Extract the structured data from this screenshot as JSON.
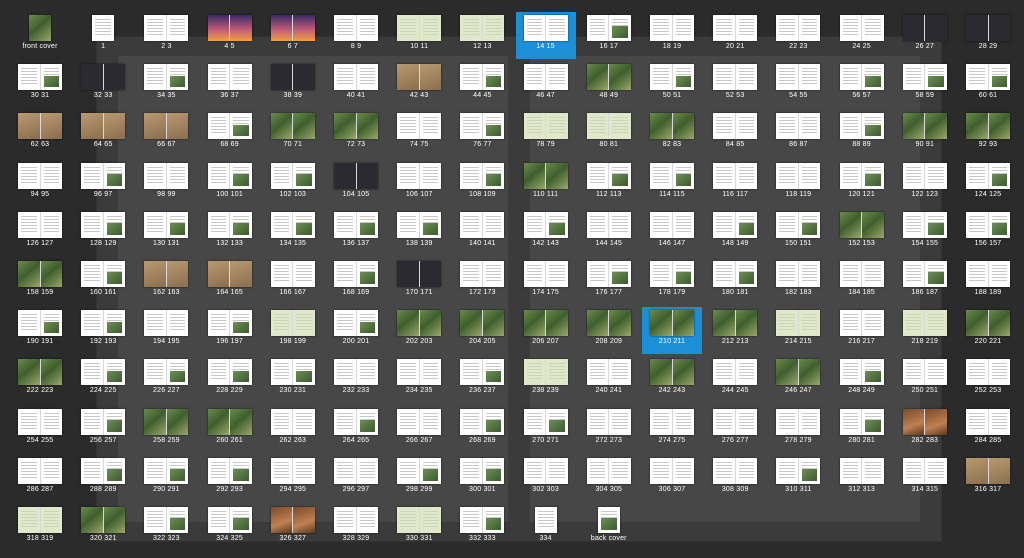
{
  "view": "page-spread-overview",
  "selected_spreads": [
    "14 15",
    "210 211"
  ],
  "theme": {
    "background": "#2b2b2b",
    "selection": "#1b8fd8",
    "label_color": "#ffffff"
  },
  "spreads": [
    {
      "label": "front cover",
      "visual": "photo"
    },
    {
      "label": "1",
      "visual": "text"
    },
    {
      "label": "2 3",
      "visual": "text"
    },
    {
      "label": "4 5",
      "visual": "sky"
    },
    {
      "label": "6 7",
      "visual": "sky"
    },
    {
      "label": "8 9",
      "visual": "text"
    },
    {
      "label": "10 11",
      "visual": "green"
    },
    {
      "label": "12 13",
      "visual": "green"
    },
    {
      "label": "14 15",
      "visual": "text"
    },
    {
      "label": "16 17",
      "visual": "mixed"
    },
    {
      "label": "18 19",
      "visual": "text"
    },
    {
      "label": "20 21",
      "visual": "text"
    },
    {
      "label": "22 23",
      "visual": "text"
    },
    {
      "label": "24 25",
      "visual": "text"
    },
    {
      "label": "26 27",
      "visual": "dark"
    },
    {
      "label": "28 29",
      "visual": "dark"
    },
    {
      "label": "30 31",
      "visual": "mixed"
    },
    {
      "label": "32 33",
      "visual": "dark"
    },
    {
      "label": "34 35",
      "visual": "mixed"
    },
    {
      "label": "36 37",
      "visual": "text"
    },
    {
      "label": "38 39",
      "visual": "dark"
    },
    {
      "label": "40 41",
      "visual": "text"
    },
    {
      "label": "42 43",
      "visual": "tan"
    },
    {
      "label": "44 45",
      "visual": "mixed"
    },
    {
      "label": "46 47",
      "visual": "text"
    },
    {
      "label": "48 49",
      "visual": "photo"
    },
    {
      "label": "50 51",
      "visual": "mixed"
    },
    {
      "label": "52 53",
      "visual": "text"
    },
    {
      "label": "54 55",
      "visual": "text"
    },
    {
      "label": "56 57",
      "visual": "mixed"
    },
    {
      "label": "58 59",
      "visual": "mixed"
    },
    {
      "label": "60 61",
      "visual": "mixed"
    },
    {
      "label": "62 63",
      "visual": "tan"
    },
    {
      "label": "64 65",
      "visual": "tan"
    },
    {
      "label": "66 67",
      "visual": "tan"
    },
    {
      "label": "68 69",
      "visual": "mixed"
    },
    {
      "label": "70 71",
      "visual": "photo"
    },
    {
      "label": "72 73",
      "visual": "photo"
    },
    {
      "label": "74 75",
      "visual": "text"
    },
    {
      "label": "76 77",
      "visual": "mixed"
    },
    {
      "label": "78 79",
      "visual": "green"
    },
    {
      "label": "80 81",
      "visual": "green"
    },
    {
      "label": "82 83",
      "visual": "photo"
    },
    {
      "label": "84 85",
      "visual": "text"
    },
    {
      "label": "86 87",
      "visual": "text"
    },
    {
      "label": "88 89",
      "visual": "mixed"
    },
    {
      "label": "90 91",
      "visual": "photo"
    },
    {
      "label": "92 93",
      "visual": "photo"
    },
    {
      "label": "94 95",
      "visual": "text"
    },
    {
      "label": "96 97",
      "visual": "mixed"
    },
    {
      "label": "98 99",
      "visual": "text"
    },
    {
      "label": "100 101",
      "visual": "mixed"
    },
    {
      "label": "102 103",
      "visual": "mixed"
    },
    {
      "label": "104 105",
      "visual": "dark"
    },
    {
      "label": "106 107",
      "visual": "text"
    },
    {
      "label": "108 109",
      "visual": "mixed"
    },
    {
      "label": "110 111",
      "visual": "photo"
    },
    {
      "label": "112 113",
      "visual": "mixed"
    },
    {
      "label": "114 115",
      "visual": "mixed"
    },
    {
      "label": "116 117",
      "visual": "text"
    },
    {
      "label": "118 119",
      "visual": "text"
    },
    {
      "label": "120 121",
      "visual": "mixed"
    },
    {
      "label": "122 123",
      "visual": "text"
    },
    {
      "label": "124 125",
      "visual": "mixed"
    },
    {
      "label": "126 127",
      "visual": "text"
    },
    {
      "label": "128 129",
      "visual": "mixed"
    },
    {
      "label": "130 131",
      "visual": "mixed"
    },
    {
      "label": "132 133",
      "visual": "mixed"
    },
    {
      "label": "134 135",
      "visual": "mixed"
    },
    {
      "label": "136 137",
      "visual": "mixed"
    },
    {
      "label": "138 139",
      "visual": "mixed"
    },
    {
      "label": "140 141",
      "visual": "text"
    },
    {
      "label": "142 143",
      "visual": "mixed"
    },
    {
      "label": "144 145",
      "visual": "text"
    },
    {
      "label": "146 147",
      "visual": "text"
    },
    {
      "label": "148 149",
      "visual": "mixed"
    },
    {
      "label": "150 151",
      "visual": "mixed"
    },
    {
      "label": "152 153",
      "visual": "photo"
    },
    {
      "label": "154 155",
      "visual": "mixed"
    },
    {
      "label": "156 157",
      "visual": "mixed"
    },
    {
      "label": "158 159",
      "visual": "photo"
    },
    {
      "label": "160 161",
      "visual": "mixed"
    },
    {
      "label": "162 163",
      "visual": "tan"
    },
    {
      "label": "164 165",
      "visual": "tan"
    },
    {
      "label": "166 167",
      "visual": "text"
    },
    {
      "label": "168 169",
      "visual": "mixed"
    },
    {
      "label": "170 171",
      "visual": "dark"
    },
    {
      "label": "172 173",
      "visual": "text"
    },
    {
      "label": "174 175",
      "visual": "text"
    },
    {
      "label": "176 177",
      "visual": "mixed"
    },
    {
      "label": "178 179",
      "visual": "mixed"
    },
    {
      "label": "180 181",
      "visual": "mixed"
    },
    {
      "label": "182 183",
      "visual": "text"
    },
    {
      "label": "184 185",
      "visual": "text"
    },
    {
      "label": "186 187",
      "visual": "mixed"
    },
    {
      "label": "188 189",
      "visual": "text"
    },
    {
      "label": "190 191",
      "visual": "mixed"
    },
    {
      "label": "192 193",
      "visual": "mixed"
    },
    {
      "label": "194 195",
      "visual": "text"
    },
    {
      "label": "196 197",
      "visual": "mixed"
    },
    {
      "label": "198 199",
      "visual": "green"
    },
    {
      "label": "200 201",
      "visual": "mixed"
    },
    {
      "label": "202 203",
      "visual": "photo"
    },
    {
      "label": "204 205",
      "visual": "photo"
    },
    {
      "label": "206 207",
      "visual": "photo"
    },
    {
      "label": "208 209",
      "visual": "photo"
    },
    {
      "label": "210 211",
      "visual": "photo"
    },
    {
      "label": "212 213",
      "visual": "photo"
    },
    {
      "label": "214 215",
      "visual": "green"
    },
    {
      "label": "216 217",
      "visual": "text"
    },
    {
      "label": "218 219",
      "visual": "green"
    },
    {
      "label": "220 221",
      "visual": "photo"
    },
    {
      "label": "222 223",
      "visual": "photo"
    },
    {
      "label": "224 225",
      "visual": "mixed"
    },
    {
      "label": "226 227",
      "visual": "mixed"
    },
    {
      "label": "228 229",
      "visual": "mixed"
    },
    {
      "label": "230 231",
      "visual": "mixed"
    },
    {
      "label": "232 233",
      "visual": "text"
    },
    {
      "label": "234 235",
      "visual": "text"
    },
    {
      "label": "236 237",
      "visual": "mixed"
    },
    {
      "label": "238 239",
      "visual": "green"
    },
    {
      "label": "240 241",
      "visual": "text"
    },
    {
      "label": "242 243",
      "visual": "photo"
    },
    {
      "label": "244 245",
      "visual": "text"
    },
    {
      "label": "246 247",
      "visual": "photo"
    },
    {
      "label": "248 249",
      "visual": "mixed"
    },
    {
      "label": "250 251",
      "visual": "text"
    },
    {
      "label": "252 253",
      "visual": "text"
    },
    {
      "label": "254 255",
      "visual": "text"
    },
    {
      "label": "256 257",
      "visual": "mixed"
    },
    {
      "label": "258 259",
      "visual": "photo"
    },
    {
      "label": "260 261",
      "visual": "photo"
    },
    {
      "label": "262 263",
      "visual": "text"
    },
    {
      "label": "264 265",
      "visual": "mixed"
    },
    {
      "label": "266 267",
      "visual": "text"
    },
    {
      "label": "268 269",
      "visual": "mixed"
    },
    {
      "label": "270 271",
      "visual": "mixed"
    },
    {
      "label": "272 273",
      "visual": "text"
    },
    {
      "label": "274 275",
      "visual": "text"
    },
    {
      "label": "276 277",
      "visual": "text"
    },
    {
      "label": "278 279",
      "visual": "text"
    },
    {
      "label": "280 281",
      "visual": "mixed"
    },
    {
      "label": "282 283",
      "visual": "brown"
    },
    {
      "label": "284 285",
      "visual": "text"
    },
    {
      "label": "286 287",
      "visual": "text"
    },
    {
      "label": "288 289",
      "visual": "mixed"
    },
    {
      "label": "290 291",
      "visual": "mixed"
    },
    {
      "label": "292 293",
      "visual": "mixed"
    },
    {
      "label": "294 295",
      "visual": "text"
    },
    {
      "label": "296 297",
      "visual": "text"
    },
    {
      "label": "298 299",
      "visual": "mixed"
    },
    {
      "label": "300 301",
      "visual": "mixed"
    },
    {
      "label": "302 303",
      "visual": "text"
    },
    {
      "label": "304 305",
      "visual": "text"
    },
    {
      "label": "306 307",
      "visual": "text"
    },
    {
      "label": "308 309",
      "visual": "text"
    },
    {
      "label": "310 311",
      "visual": "mixed"
    },
    {
      "label": "312 313",
      "visual": "text"
    },
    {
      "label": "314 315",
      "visual": "text"
    },
    {
      "label": "316 317",
      "visual": "tan"
    },
    {
      "label": "318 319",
      "visual": "green"
    },
    {
      "label": "320 321",
      "visual": "photo"
    },
    {
      "label": "322 323",
      "visual": "mixed"
    },
    {
      "label": "324 325",
      "visual": "mixed"
    },
    {
      "label": "326 327",
      "visual": "brown"
    },
    {
      "label": "328 329",
      "visual": "text"
    },
    {
      "label": "330 331",
      "visual": "green"
    },
    {
      "label": "332 333",
      "visual": "mixed"
    },
    {
      "label": "334",
      "visual": "text"
    },
    {
      "label": "back cover",
      "visual": "mixed"
    }
  ]
}
